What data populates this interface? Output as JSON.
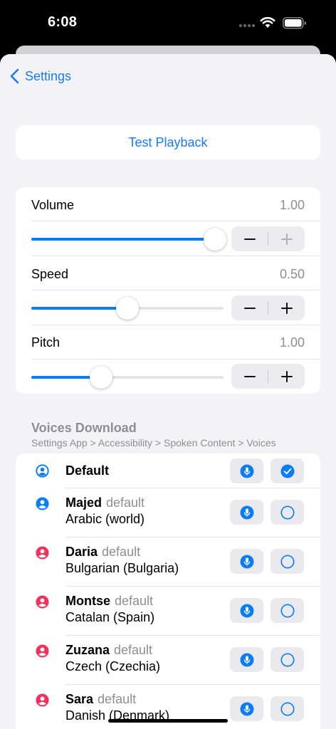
{
  "status": {
    "time": "6:08"
  },
  "nav": {
    "back_label": "Settings"
  },
  "test_playback_label": "Test Playback",
  "sliders": [
    {
      "label": "Volume",
      "value": "1.00",
      "fraction": 1.0
    },
    {
      "label": "Speed",
      "value": "0.50",
      "fraction": 0.5
    },
    {
      "label": "Pitch",
      "value": "1.00",
      "fraction": 0.35
    }
  ],
  "voices_section": {
    "title": "Voices Download",
    "subtitle": "Settings App > Accessibility > Spoken Content > Voices"
  },
  "voices": [
    {
      "name": "Default",
      "default_tag": "",
      "language": "",
      "icon": "person-circle-outline-icon",
      "icon_color": "#0a7cf5",
      "selected": true
    },
    {
      "name": "Majed",
      "default_tag": "default",
      "language": "Arabic (world)",
      "icon": "person-circle-fill-icon",
      "icon_color": "#0a7cf5",
      "selected": false
    },
    {
      "name": "Daria",
      "default_tag": "default",
      "language": "Bulgarian (Bulgaria)",
      "icon": "person-circle-fill-icon",
      "icon_color": "#f5315b",
      "selected": false
    },
    {
      "name": "Montse",
      "default_tag": "default",
      "language": "Catalan (Spain)",
      "icon": "person-circle-fill-icon",
      "icon_color": "#f5315b",
      "selected": false
    },
    {
      "name": "Zuzana",
      "default_tag": "default",
      "language": "Czech (Czechia)",
      "icon": "person-circle-fill-icon",
      "icon_color": "#f5315b",
      "selected": false
    },
    {
      "name": "Sara",
      "default_tag": "default",
      "language": "Danish (Denmark)",
      "icon": "person-circle-fill-icon",
      "icon_color": "#f5315b",
      "selected": false
    }
  ],
  "colors": {
    "accent": "#0a7cf5",
    "female": "#f5315b",
    "background": "#f2f2f7"
  }
}
